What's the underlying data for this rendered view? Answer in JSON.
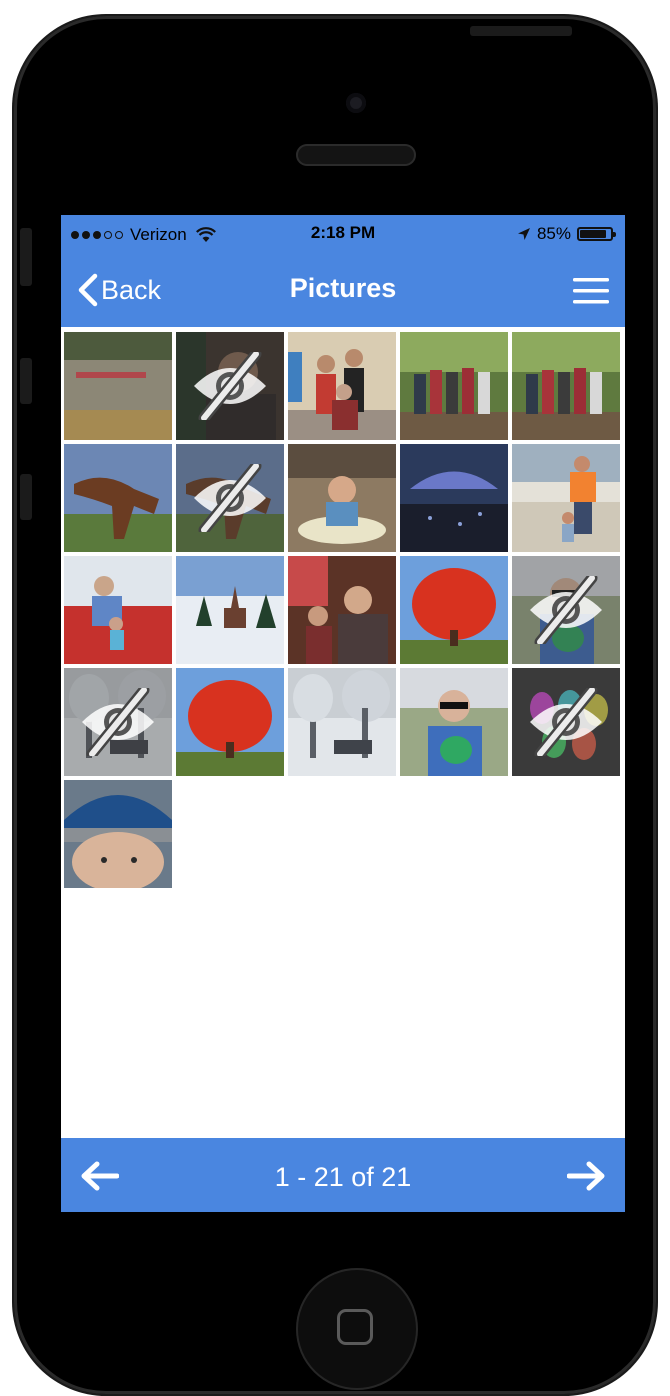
{
  "status_bar": {
    "carrier": "Verizon",
    "time": "2:18 PM",
    "battery_percent": "85%",
    "battery_level": 0.85,
    "signal_bars_filled": 3,
    "signal_bars_total": 5
  },
  "nav": {
    "back_label": "Back",
    "title": "Pictures",
    "menu_icon": "hamburger-menu-icon"
  },
  "gallery": {
    "photos": [
      {
        "subject": "river",
        "hidden": false
      },
      {
        "subject": "person",
        "hidden": true
      },
      {
        "subject": "group",
        "hidden": false
      },
      {
        "subject": "group-forest",
        "hidden": false
      },
      {
        "subject": "group-forest",
        "hidden": false
      },
      {
        "subject": "horse",
        "hidden": false
      },
      {
        "subject": "horse",
        "hidden": true
      },
      {
        "subject": "baby-chair",
        "hidden": false
      },
      {
        "subject": "concert",
        "hidden": false
      },
      {
        "subject": "beach",
        "hidden": false
      },
      {
        "subject": "tractor",
        "hidden": false
      },
      {
        "subject": "winter-church",
        "hidden": false
      },
      {
        "subject": "family-room",
        "hidden": false
      },
      {
        "subject": "red-tree",
        "hidden": false
      },
      {
        "subject": "toddler",
        "hidden": true
      },
      {
        "subject": "snow",
        "hidden": true
      },
      {
        "subject": "red-tree",
        "hidden": false
      },
      {
        "subject": "snow",
        "hidden": false
      },
      {
        "subject": "toddler",
        "hidden": false
      },
      {
        "subject": "eggs",
        "hidden": true
      },
      {
        "subject": "baby-hat",
        "hidden": false
      }
    ]
  },
  "pager": {
    "label": "1 - 21 of 21",
    "prev_icon": "arrow-left-icon",
    "next_icon": "arrow-right-icon"
  },
  "colors": {
    "accent": "#4a86e0",
    "text_on_accent": "#ffffff"
  }
}
